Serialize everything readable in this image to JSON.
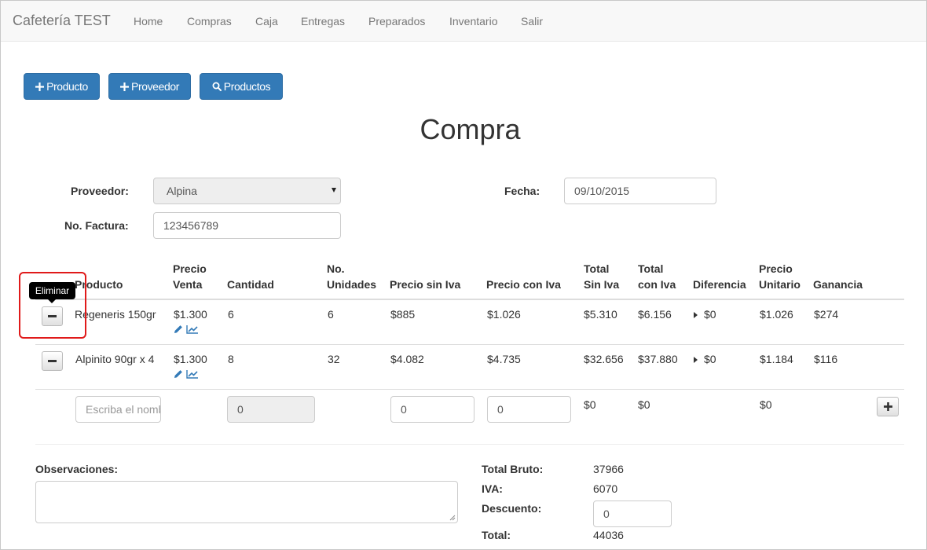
{
  "navbar": {
    "brand": "Cafetería TEST",
    "links": [
      "Home",
      "Compras",
      "Caja",
      "Entregas",
      "Preparados",
      "Inventario",
      "Salir"
    ]
  },
  "toolbar": {
    "add_product": "Producto",
    "add_supplier": "Proveedor",
    "search_products": "Productos"
  },
  "page_title": "Compra",
  "form": {
    "supplier_label": "Proveedor:",
    "supplier_value": "Alpina",
    "date_label": "Fecha:",
    "date_value": "09/10/2015",
    "invoice_label": "No. Factura:",
    "invoice_value": "123456789"
  },
  "table": {
    "headers": {
      "producto": "Producto",
      "precio_venta_1": "Precio",
      "precio_venta_2": "Venta",
      "cantidad": "Cantidad",
      "unidades_1": "No.",
      "unidades_2": "Unidades",
      "sin_iva": "Precio sin Iva",
      "con_iva": "Precio con Iva",
      "total_sin_1": "Total",
      "total_sin_2": "Sin Iva",
      "total_con_1": "Total",
      "total_con_2": "con Iva",
      "diferencia": "Diferencia",
      "unitario_1": "Precio",
      "unitario_2": "Unitario",
      "ganancia": "Ganancia"
    },
    "rows": [
      {
        "producto": "Regeneris 150gr",
        "precio_venta": "$1.300",
        "cantidad": "6",
        "unidades": "6",
        "sin_iva": "$885",
        "con_iva": "$1.026",
        "total_sin_iva": "$5.310",
        "total_con_iva": "$6.156",
        "diferencia": "$0",
        "precio_unitario": "$1.026",
        "ganancia": "$274"
      },
      {
        "producto": "Alpinito 90gr x 4",
        "precio_venta": "$1.300",
        "cantidad": "8",
        "unidades": "32",
        "sin_iva": "$4.082",
        "con_iva": "$4.735",
        "total_sin_iva": "$32.656",
        "total_con_iva": "$37.880",
        "diferencia": "$0",
        "precio_unitario": "$1.184",
        "ganancia": "$116"
      }
    ],
    "new_row": {
      "product_placeholder": "Escriba el nombre",
      "cantidad": "0",
      "sin_iva": "0",
      "con_iva": "0",
      "total_sin_iva": "$0",
      "total_con_iva": "$0",
      "precio_unitario": "$0"
    }
  },
  "tooltip": "Eliminar",
  "observaciones_label": "Observaciones:",
  "summary": {
    "bruto_label": "Total Bruto:",
    "bruto_value": "37966",
    "iva_label": "IVA:",
    "iva_value": "6070",
    "descuento_label": "Descuento:",
    "descuento_value": "0",
    "total_label": "Total:",
    "total_value": "44036"
  },
  "colors": {
    "primary": "#337ab7",
    "highlight": "#e01a1a",
    "link_icon": "#337ab7"
  }
}
